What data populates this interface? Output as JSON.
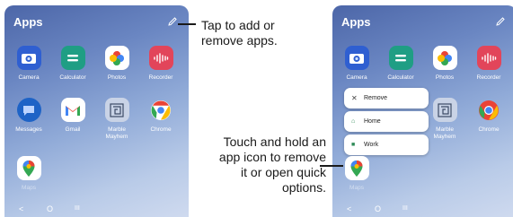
{
  "phone_left": {
    "title": "Apps",
    "apps": [
      {
        "label": "Camera"
      },
      {
        "label": "Calculator"
      },
      {
        "label": "Photos"
      },
      {
        "label": "Recorder"
      },
      {
        "label": "Messages"
      },
      {
        "label": "Gmail"
      },
      {
        "label": "Marble Mayhem"
      },
      {
        "label": "Chrome"
      },
      {
        "label": "Maps"
      }
    ],
    "nav": {
      "back": "<",
      "home": "O",
      "recents": "III"
    }
  },
  "phone_right": {
    "title": "Apps",
    "apps": [
      {
        "label": "Camera"
      },
      {
        "label": "Calculator"
      },
      {
        "label": "Photos"
      },
      {
        "label": "Recorder"
      },
      {
        "label": "Marble Mayhem"
      },
      {
        "label": "Chrome"
      },
      {
        "label": "Maps"
      }
    ],
    "menu": [
      {
        "label": "Remove"
      },
      {
        "label": "Home"
      },
      {
        "label": "Work"
      }
    ],
    "nav": {
      "back": "<",
      "home": "O",
      "recents": "III"
    }
  },
  "callouts": {
    "top": "Tap to add or remove apps.",
    "bottom": "Touch and hold an app icon to remove it or open quick options."
  }
}
